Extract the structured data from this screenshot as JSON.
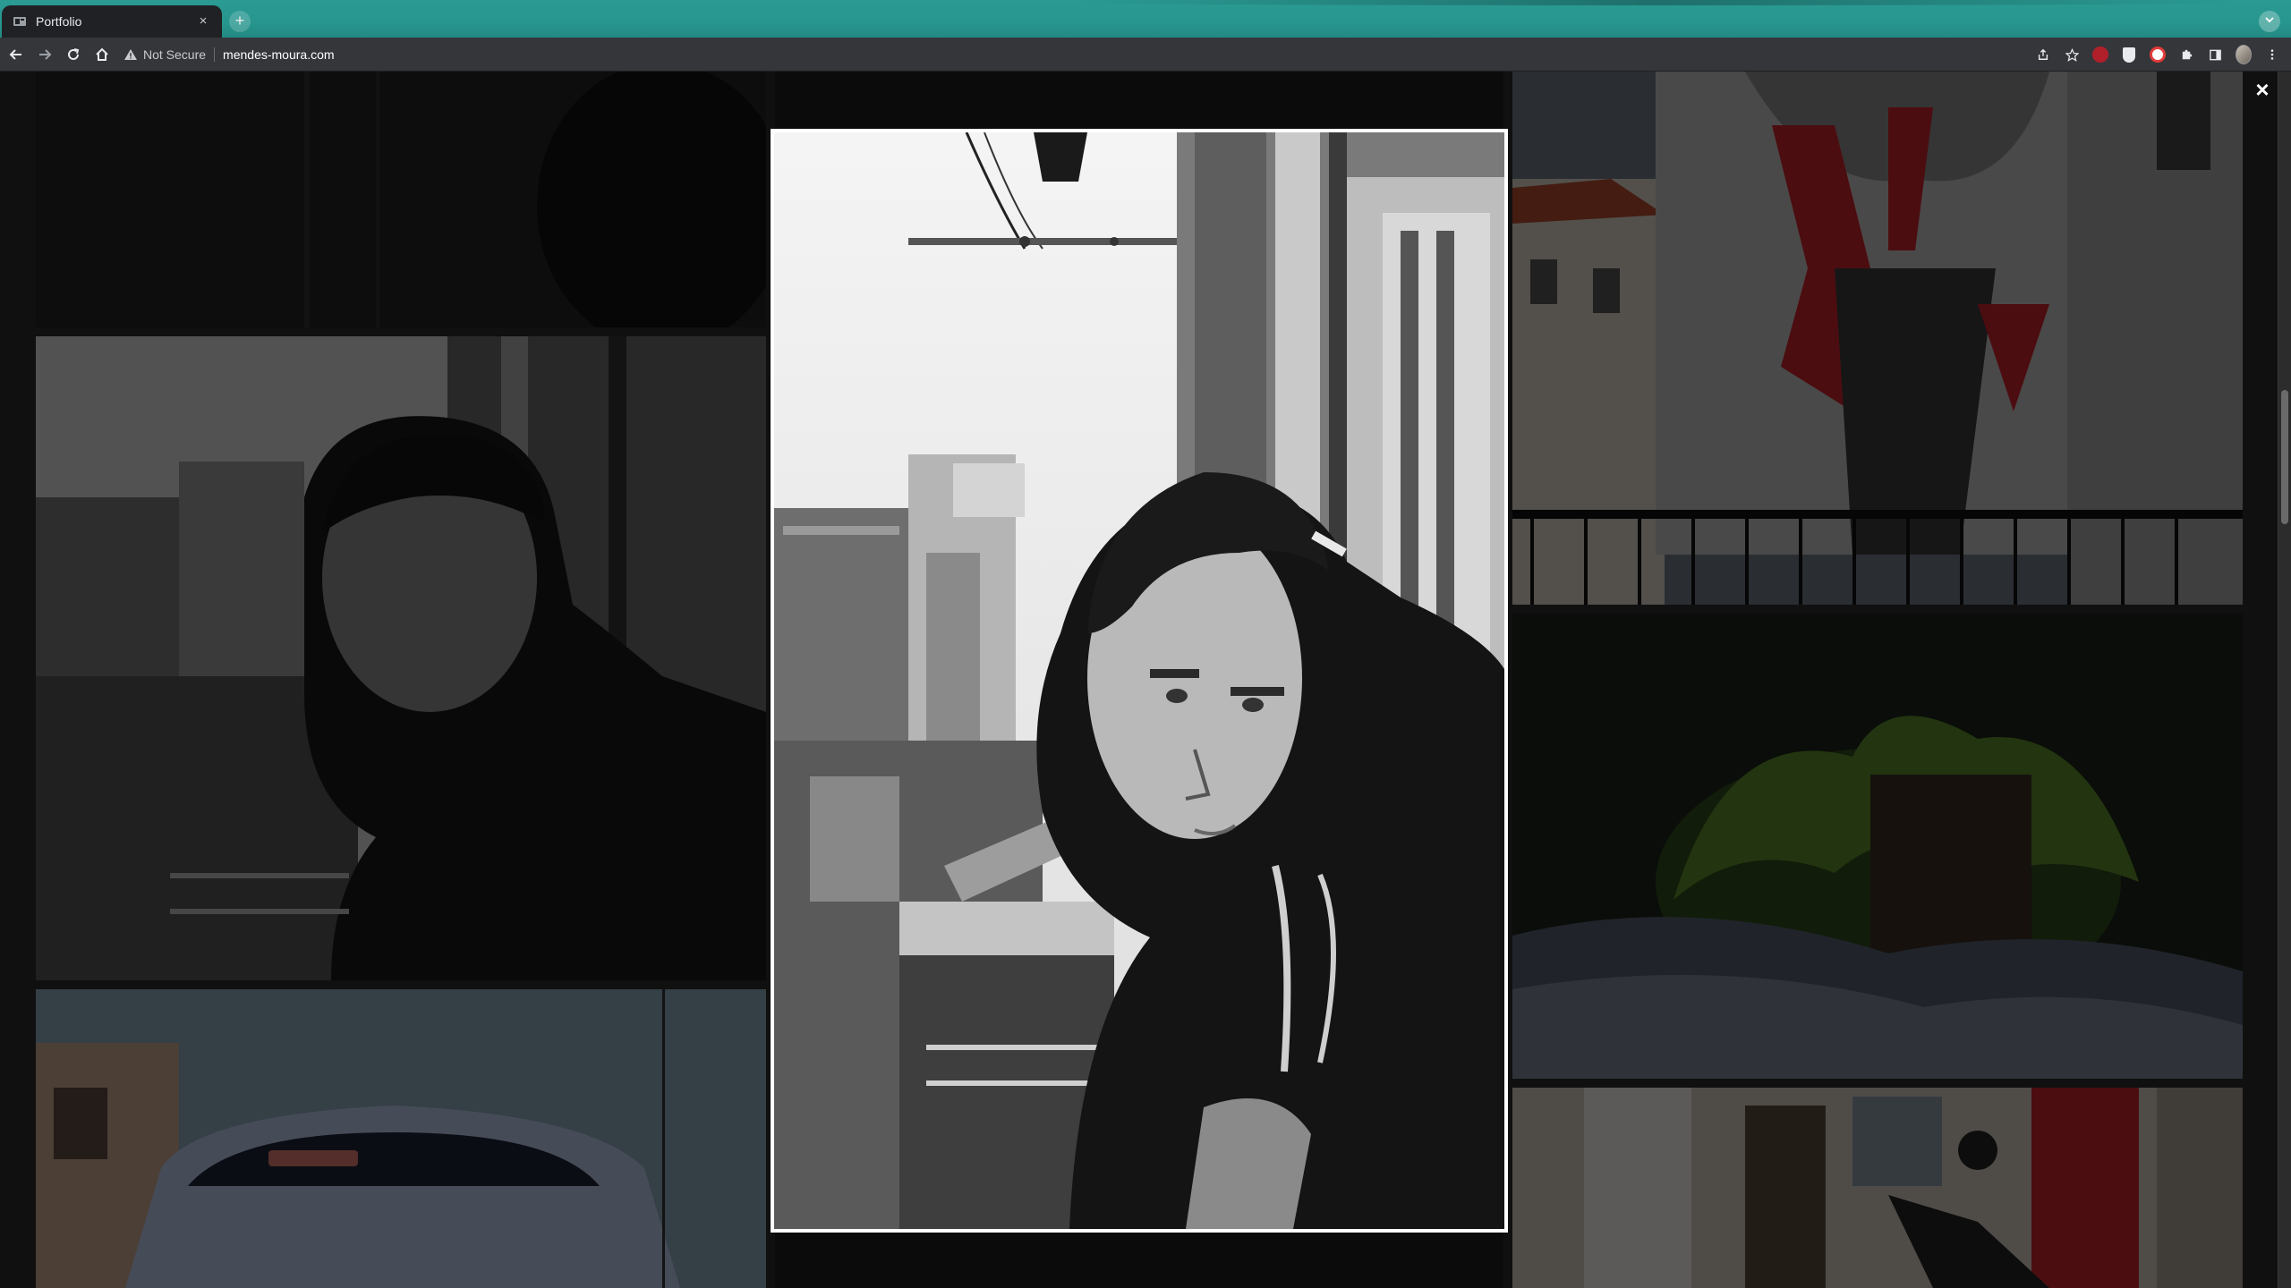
{
  "browser": {
    "tab_title": "Portfolio",
    "new_tab_symbol": "+",
    "close_tab_symbol": "×",
    "security_label": "Not Secure",
    "url": "mendes-moura.com"
  },
  "lightbox": {
    "close_symbol": "×"
  },
  "icons": {
    "favicon": "portfolio-favicon",
    "back": "arrow-back-icon",
    "forward": "arrow-forward-icon",
    "reload": "reload-icon",
    "home": "home-icon",
    "warning": "warning-triangle-icon",
    "share": "share-icon",
    "bookmark": "star-icon",
    "extensions": "puzzle-icon",
    "sidepanel": "sidepanel-icon",
    "menu": "kebab-menu-icon"
  },
  "colors": {
    "tab_strip": "#26968e",
    "toolbar": "#35363a",
    "page_bg": "#2a2a2a",
    "accent_red": "#c8242c"
  }
}
